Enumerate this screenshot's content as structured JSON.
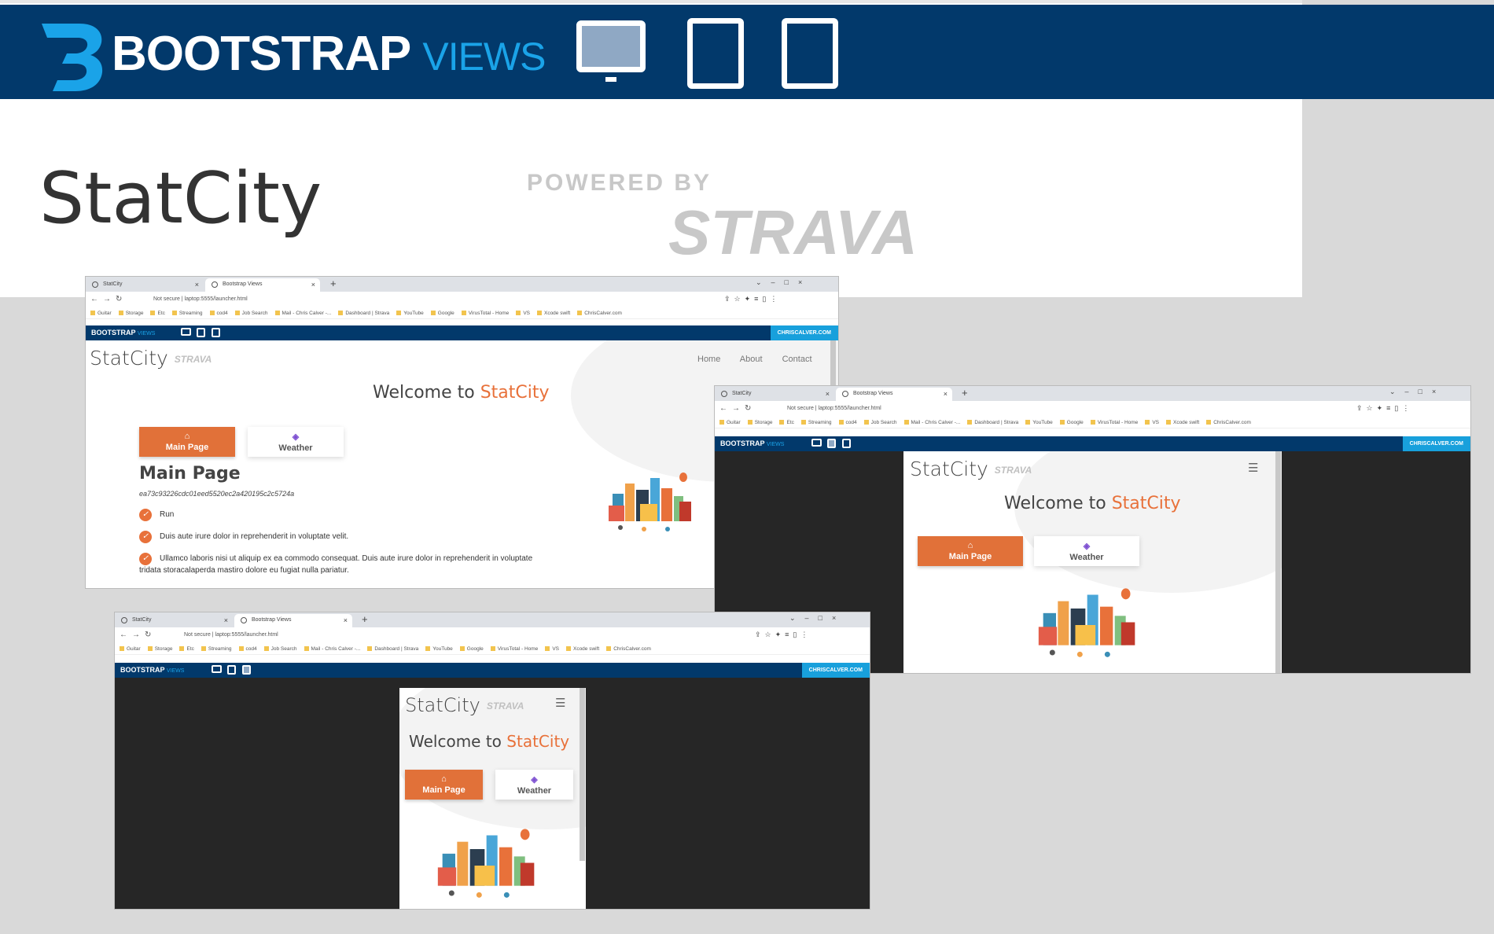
{
  "banner": {
    "brand_main": "BOOTSTRAP",
    "brand_sub": "VIEWS",
    "site_title": "StatCity",
    "powered_by": "POWERED BY",
    "strava": "STRAVA"
  },
  "windows": [
    {
      "tabs": [
        "StatCity",
        "Bootstrap Views"
      ],
      "url": "Not secure | laptop:5555/launcher.html"
    },
    {
      "tabs": [
        "StatCity",
        "Bootstrap Views"
      ],
      "url": "Not secure | laptop:5555/launcher.html"
    },
    {
      "tabs": [
        "StatCity",
        "Bootstrap Views"
      ],
      "url": "Not secure | laptop:5555/launcher.html"
    }
  ],
  "bookmarks": [
    "Guitar",
    "Storage",
    "Etc",
    "Streaming",
    "cod4",
    "Job Search",
    "Mail - Chris Calver -...",
    "Dashboard | Strava",
    "YouTube",
    "Google",
    "VirusTotal - Home",
    "VS",
    "Xcode swift",
    "ChrisCalver.com"
  ],
  "bv_bar": {
    "brand": "BOOTSTRAP",
    "sub": "VIEWS",
    "site_link": "CHRISCALVER.COM"
  },
  "site": {
    "title": "StatCity",
    "strava": "STRAVA",
    "nav": [
      "Home",
      "About",
      "Contact"
    ],
    "welcome_prefix": "Welcome to ",
    "welcome_brand": "StatCity",
    "tab_main": "Main Page",
    "tab_weather": "Weather",
    "section_title": "Main Page",
    "hash": "ea73c93226cdc01eed5520ec2a420195c2c5724a",
    "items": [
      "Run",
      "Duis aute irure dolor in reprehenderit in voluptate velit.",
      "Ullamco laboris nisi ut aliquip ex ea commodo consequat. Duis aute irure dolor in reprehenderit in voluptate",
      "tridata storacalaperda mastiro dolore eu fugiat nulla pariatur."
    ]
  },
  "colors": {
    "navy": "#02396b",
    "accent": "#e8713a",
    "cyan": "#18a0dc",
    "dark": "#262626"
  }
}
